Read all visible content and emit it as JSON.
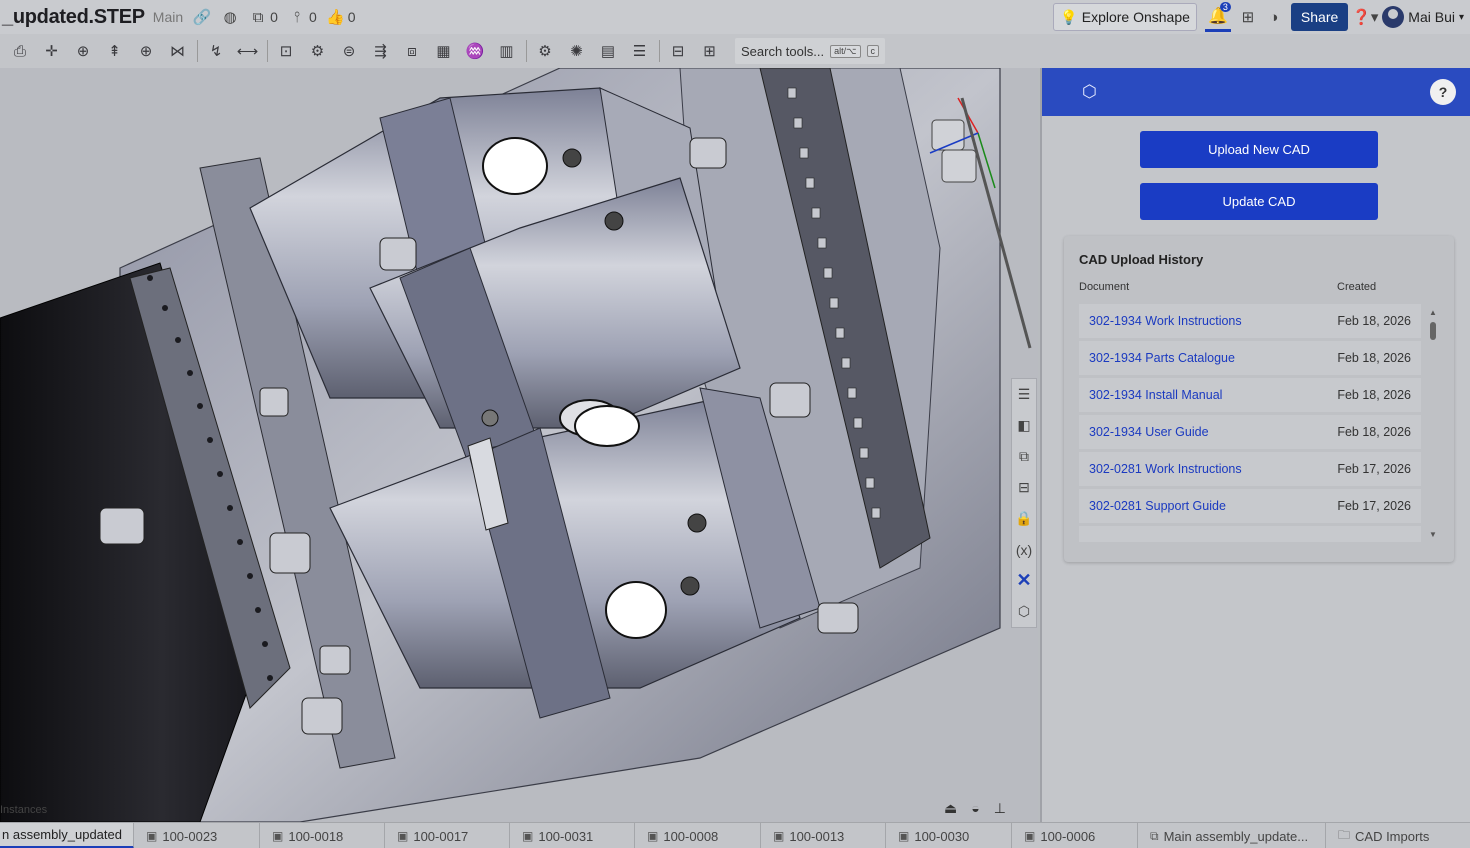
{
  "header": {
    "doc_title": "_updated.STEP",
    "branch": "Main",
    "versions_count": "0",
    "branches_count": "0",
    "likes_count": "0",
    "explore_label": "Explore Onshape",
    "notif_count": "3",
    "share_label": "Share",
    "user_name": "Mai Bui"
  },
  "toolbar": {
    "search_label": "Search tools...",
    "kbd1": "alt/⌥",
    "kbd2": "c"
  },
  "viewport": {
    "mates_label": "Instances"
  },
  "panel": {
    "upload_label": "Upload New CAD",
    "update_label": "Update CAD",
    "history_title": "CAD Upload History",
    "col_document": "Document",
    "col_created": "Created",
    "rows": [
      {
        "doc": "302-1934 Work Instructions",
        "date": "Feb 18, 2026"
      },
      {
        "doc": "302-1934 Parts Catalogue",
        "date": "Feb 18, 2026"
      },
      {
        "doc": "302-1934 Install Manual",
        "date": "Feb 18, 2026"
      },
      {
        "doc": "302-1934 User Guide",
        "date": "Feb 18, 2026"
      },
      {
        "doc": "302-0281 Work Instructions",
        "date": "Feb 17, 2026"
      },
      {
        "doc": "302-0281 Support Guide",
        "date": "Feb 17, 2026"
      },
      {
        "doc": "...",
        "date": "..."
      }
    ]
  },
  "tabs": [
    {
      "label": "n assembly_updated",
      "icon": "assembly-icon"
    },
    {
      "label": "100-0023",
      "icon": "part-studio-icon"
    },
    {
      "label": "100-0018",
      "icon": "part-studio-icon"
    },
    {
      "label": "100-0017",
      "icon": "part-studio-icon"
    },
    {
      "label": "100-0031",
      "icon": "part-studio-icon"
    },
    {
      "label": "100-0008",
      "icon": "part-studio-icon"
    },
    {
      "label": "100-0013",
      "icon": "part-studio-icon"
    },
    {
      "label": "100-0030",
      "icon": "part-studio-icon"
    },
    {
      "label": "100-0006",
      "icon": "part-studio-icon"
    },
    {
      "label": "Main assembly_update...",
      "icon": "assembly-icon"
    },
    {
      "label": "CAD Imports",
      "icon": "folder-icon"
    }
  ]
}
